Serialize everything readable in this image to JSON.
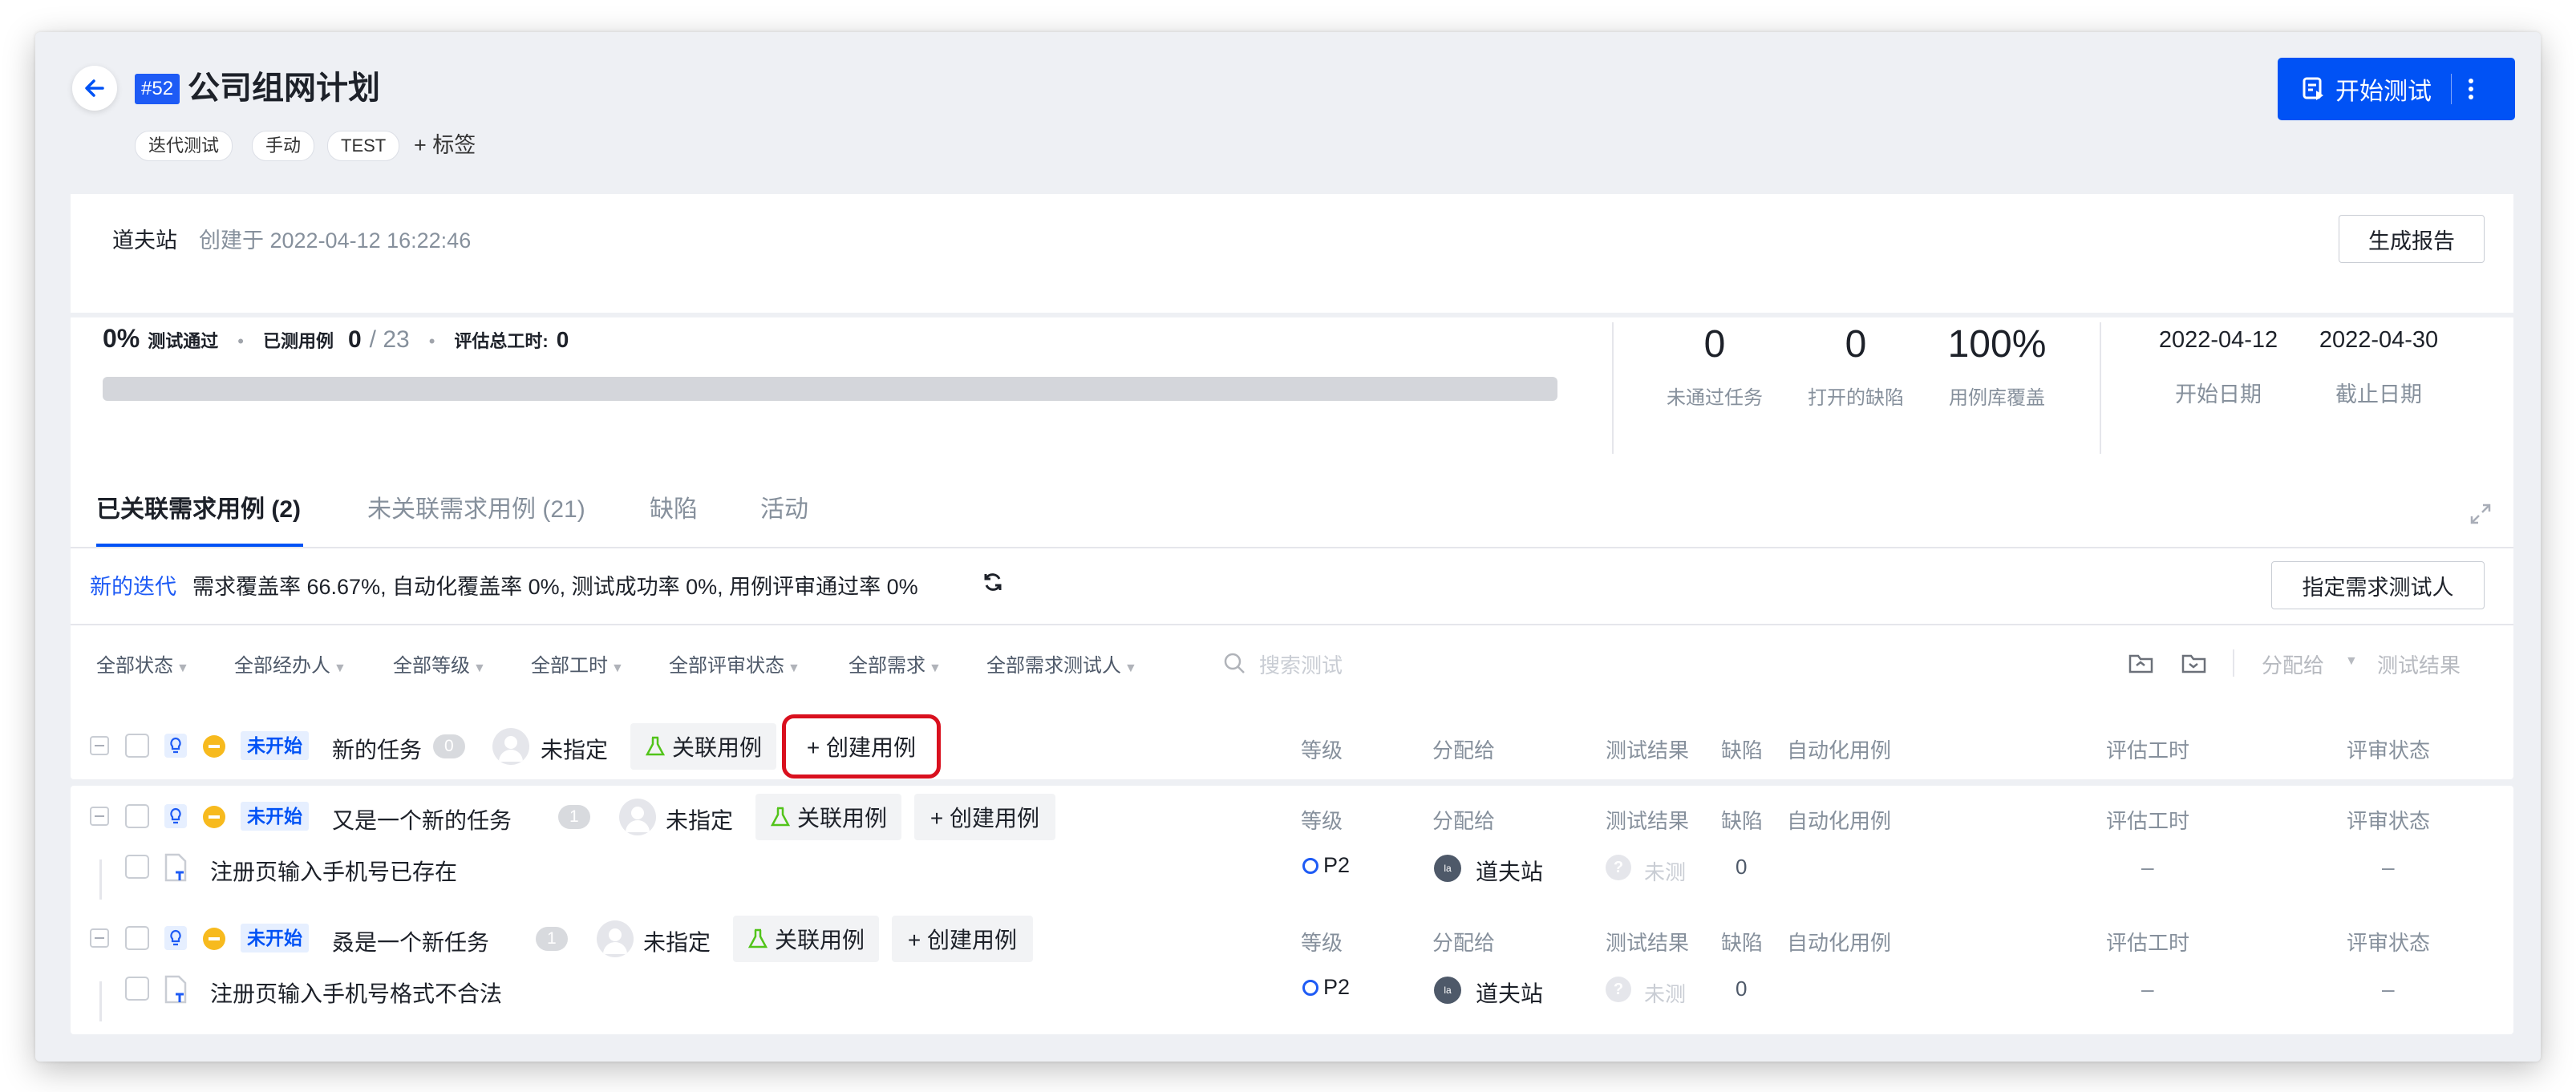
{
  "header": {
    "id_badge": "#52",
    "title": "公司组网计划",
    "tags": [
      "迭代测试",
      "手动",
      "TEST"
    ],
    "add_tag_label": "+ 标签",
    "start_test_label": "开始测试"
  },
  "info": {
    "creator": "道夫站",
    "created_at": "创建于 2022-04-12 16:22:46",
    "report_button": "生成报告"
  },
  "summary": {
    "pass_pct": "0%",
    "pass_label": "测试通过",
    "tested_label": "已测用例",
    "tested_done": "0",
    "tested_total": "/ 23",
    "hours_label": "评估总工时:",
    "hours_value": "0",
    "progress_fraction": 0,
    "stats": [
      {
        "value": "0",
        "label": "未通过任务"
      },
      {
        "value": "0",
        "label": "打开的缺陷"
      },
      {
        "value": "100%",
        "label": "用例库覆盖"
      }
    ],
    "start_date": "2022-04-12",
    "start_date_label": "开始日期",
    "end_date": "2022-04-30",
    "end_date_label": "截止日期"
  },
  "tabs": [
    {
      "label": "已关联需求用例 (2)",
      "active": true
    },
    {
      "label": "未关联需求用例 (21)",
      "active": false
    },
    {
      "label": "缺陷",
      "active": false
    },
    {
      "label": "活动",
      "active": false
    }
  ],
  "iteration": {
    "link": "新的迭代",
    "text": "需求覆盖率 66.67%, 自动化覆盖率 0%, 测试成功率 0%, 用例评审通过率 0%",
    "assign_button": "指定需求测试人"
  },
  "filters": [
    "全部状态",
    "全部经办人",
    "全部等级",
    "全部工时",
    "全部评审状态",
    "全部需求",
    "全部需求测试人"
  ],
  "search_placeholder": "搜索测试",
  "toolbar_right": {
    "assign": "分配给",
    "result": "测试结果"
  },
  "columns": {
    "level": "等级",
    "assignee": "分配给",
    "result": "测试结果",
    "defect": "缺陷",
    "automation": "自动化用例",
    "hours": "评估工时",
    "review": "评审状态"
  },
  "groups": [
    {
      "status": "未开始",
      "name": "新的任务",
      "count": "0",
      "assignee": "未指定",
      "link_label": "关联用例",
      "create_label": "+ 创建用例",
      "cases": []
    },
    {
      "status": "未开始",
      "name": "又是一个新的任务",
      "count": "1",
      "assignee": "未指定",
      "link_label": "关联用例",
      "create_label": "+ 创建用例",
      "cases": [
        {
          "title": "注册页输入手机号已存在",
          "level": "P2",
          "avatar": "la",
          "assignee": "道夫站",
          "result": "未测",
          "defects": "0",
          "hours": "–",
          "review": "–"
        }
      ]
    },
    {
      "status": "未开始",
      "name": "叒是一个新任务",
      "count": "1",
      "assignee": "未指定",
      "link_label": "关联用例",
      "create_label": "+ 创建用例",
      "cases": [
        {
          "title": "注册页输入手机号格式不合法",
          "level": "P2",
          "avatar": "la",
          "assignee": "道夫站",
          "result": "未测",
          "defects": "0",
          "hours": "–",
          "review": "–"
        }
      ]
    }
  ],
  "colors": {
    "primary": "#0052f5",
    "highlight": "#d9101e",
    "badge_bg": "#e6efff",
    "flask": "#52c41a",
    "priority": "#f7ba1e"
  }
}
